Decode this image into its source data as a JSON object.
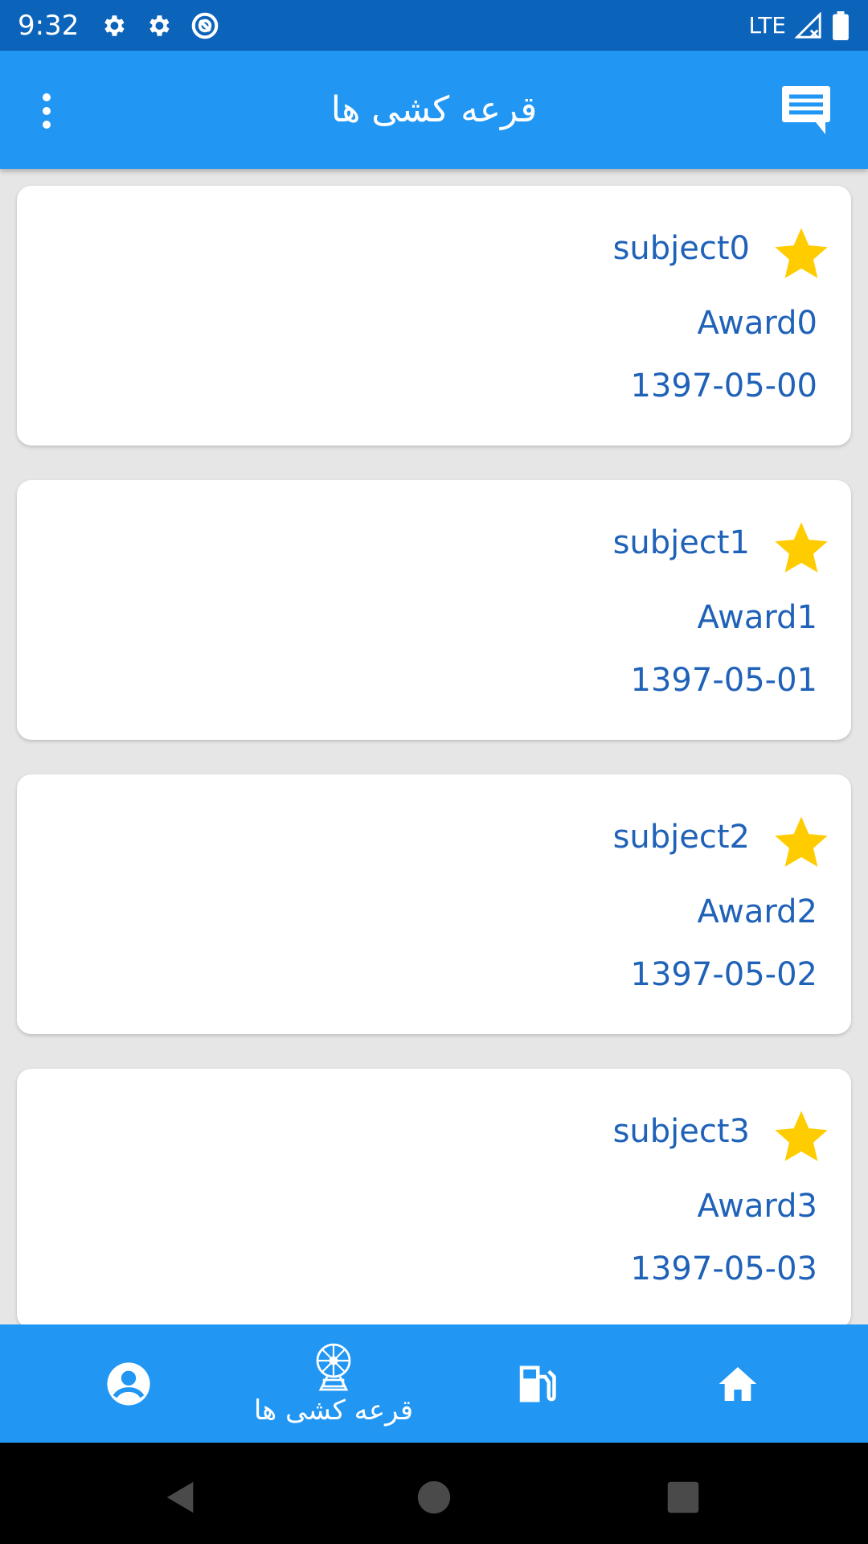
{
  "status_bar": {
    "time": "9:32",
    "network": "LTE",
    "icons": [
      "settings-icon",
      "settings-icon",
      "data-saver-icon",
      "signal-icon",
      "battery-icon"
    ]
  },
  "app_bar": {
    "title": "قرعه کشی ها",
    "left_icon": "more-vert-icon",
    "right_icon": "message-icon",
    "color": "#2196f3"
  },
  "cards": [
    {
      "subject": "subject0",
      "award": "Award0",
      "date": "1397-05-00"
    },
    {
      "subject": "subject1",
      "award": "Award1",
      "date": "1397-05-01"
    },
    {
      "subject": "subject2",
      "award": "Award2",
      "date": "1397-05-02"
    },
    {
      "subject": "subject3",
      "award": "Award3",
      "date": "1397-05-03"
    }
  ],
  "card_star_color": "#ffcc00",
  "text_color": "#1f62b8",
  "bottom_nav": {
    "items": [
      {
        "icon": "account-circle-icon",
        "label": ""
      },
      {
        "icon": "ferris-wheel-icon",
        "label": "قرعه کشی ها",
        "selected": true
      },
      {
        "icon": "gas-station-icon",
        "label": ""
      },
      {
        "icon": "home-icon",
        "label": ""
      }
    ]
  },
  "system_nav": {
    "icons": [
      "back-icon",
      "home-circle-icon",
      "recents-icon"
    ]
  }
}
